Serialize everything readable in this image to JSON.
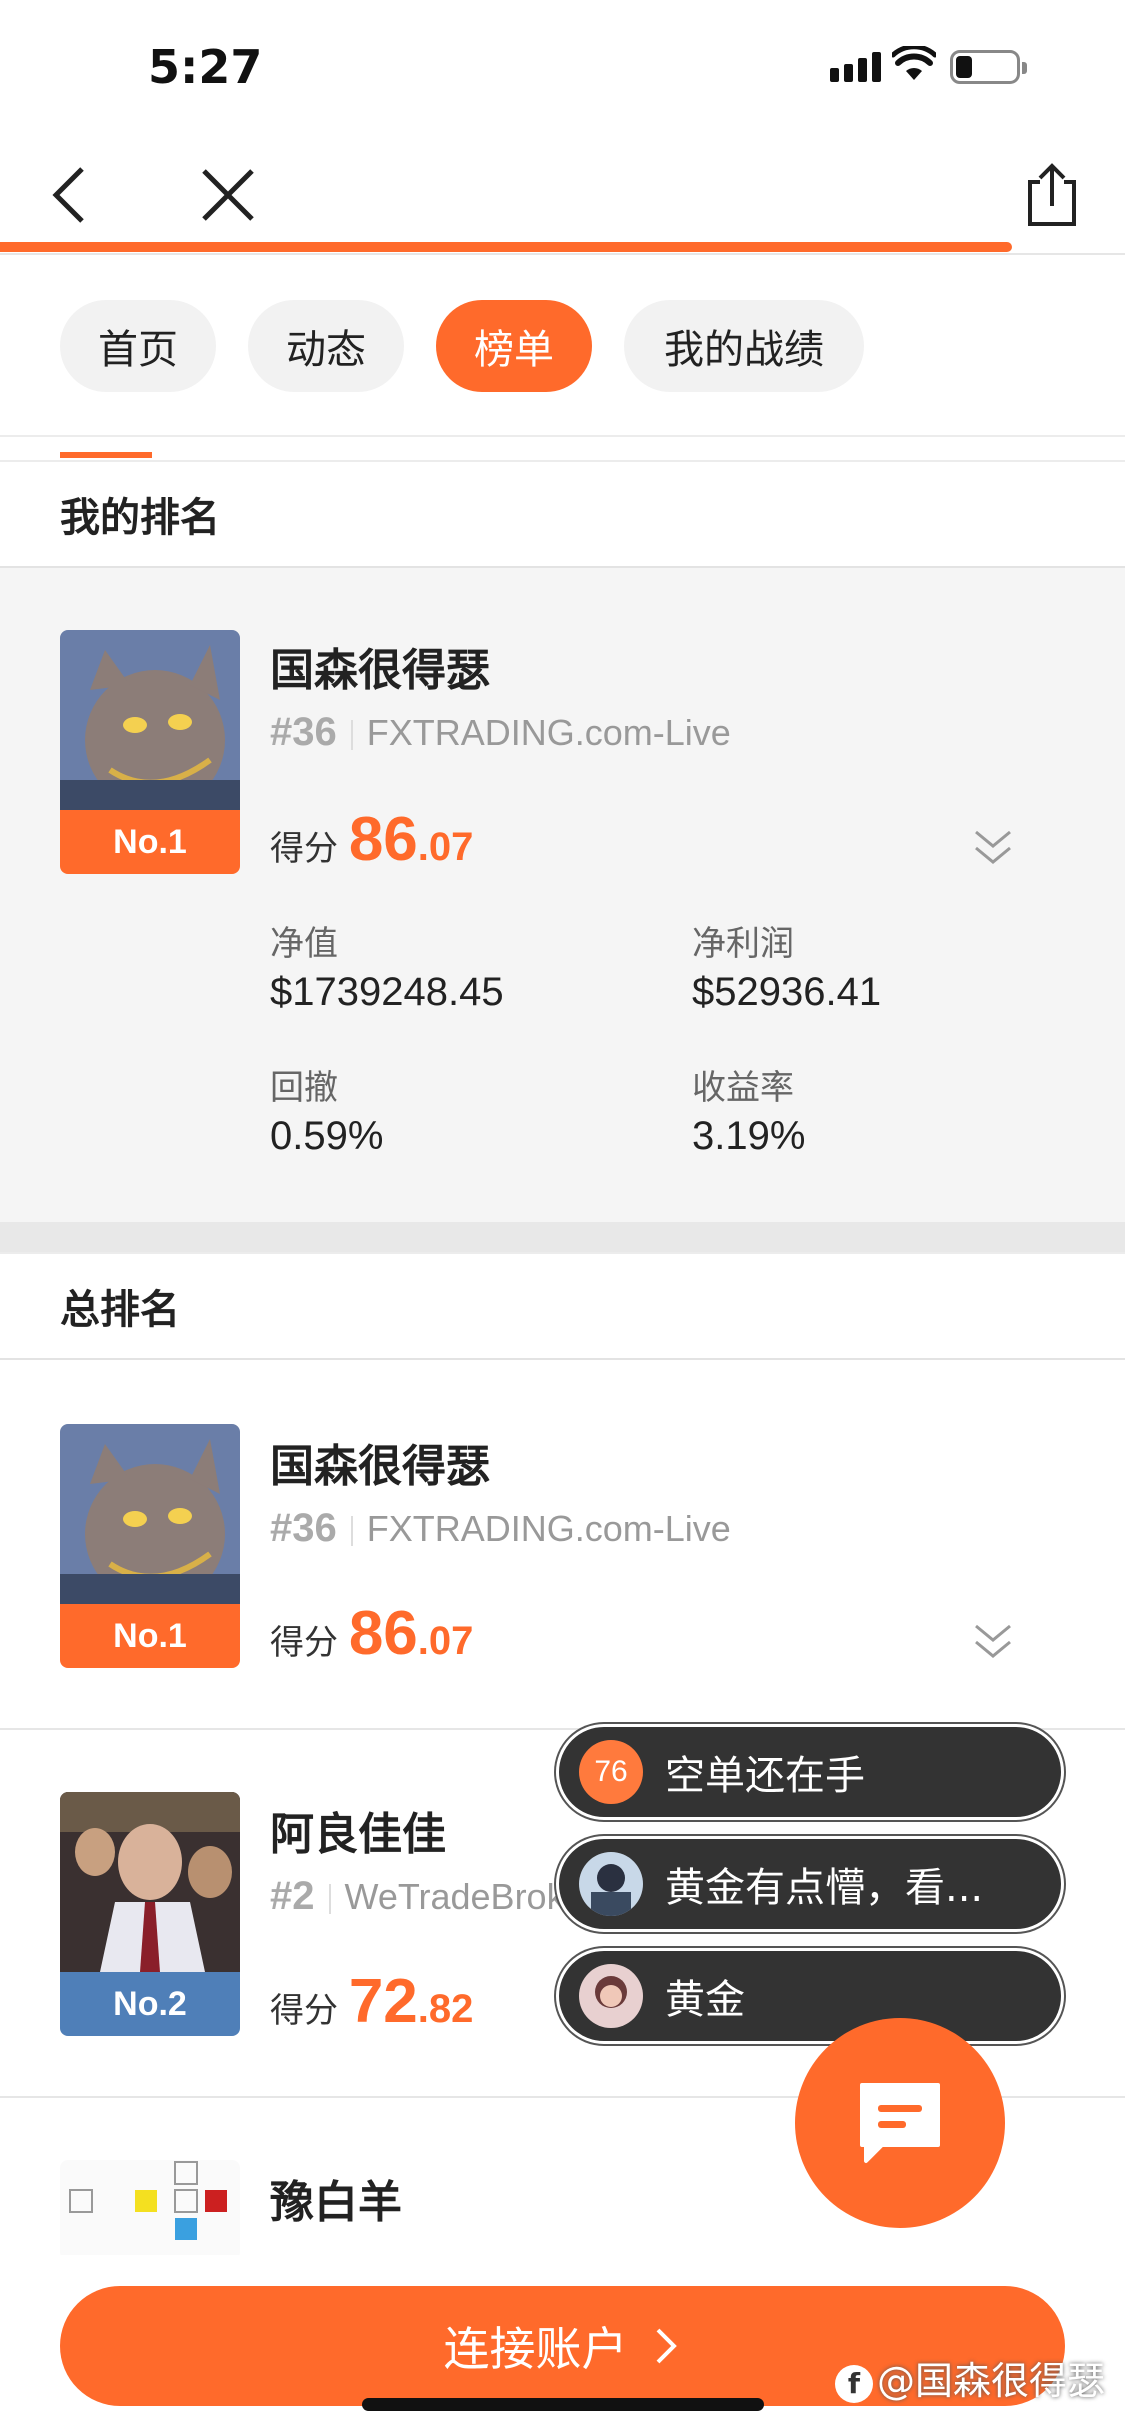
{
  "status": {
    "time": "5:27"
  },
  "tabs": [
    {
      "label": "首页"
    },
    {
      "label": "动态"
    },
    {
      "label": "榜单"
    },
    {
      "label": "我的战绩"
    }
  ],
  "my_rank": {
    "title": "我的排名",
    "name": "国森很得瑟",
    "rank_badge": "No.1",
    "num": "#36",
    "broker": "FXTRADING.com-Live",
    "score_label": "得分",
    "score_int": "86",
    "score_dec": ".07",
    "stats": {
      "equity_label": "净值",
      "equity": "$1739248.45",
      "profit_label": "净利润",
      "profit": "$52936.41",
      "drawdown_label": "回撤",
      "drawdown": "0.59%",
      "return_label": "收益率",
      "return": "3.19%"
    }
  },
  "overall": {
    "title": "总排名",
    "items": [
      {
        "name": "国森很得瑟",
        "rank_badge": "No.1",
        "num": "#36",
        "broker": "FXTRADING.com-Live",
        "score_label": "得分",
        "score_int": "86",
        "score_dec": ".07"
      },
      {
        "name": "阿良佳佳",
        "rank_badge": "No.2",
        "num": "#2",
        "broker": "WeTradeBroker-Live",
        "score_label": "得分",
        "score_int": "72",
        "score_dec": ".82"
      },
      {
        "name": "豫白羊"
      }
    ]
  },
  "chat_bubbles": [
    {
      "badge": "76",
      "text": "空单还在手"
    },
    {
      "text": "黄金有点懵，看..."
    },
    {
      "text": "黄金"
    }
  ],
  "connect_button": "连接账户",
  "watermark": "@国森很得瑟",
  "colors": {
    "accent": "#ff6a2b",
    "badge_blue": "#4f7fb8"
  }
}
